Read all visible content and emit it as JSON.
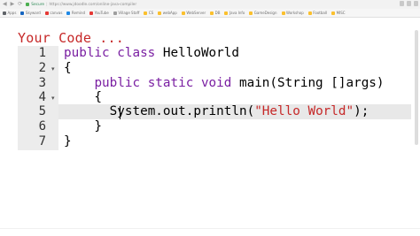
{
  "browser": {
    "secure_label": "Secure",
    "url": "https://www.jdoodle.com/online-java-compiler"
  },
  "bookmarks": [
    {
      "label": "Apps",
      "color": "#5f6368"
    },
    {
      "label": "Skyward",
      "color": "#1565c0"
    },
    {
      "label": "canvas",
      "color": "#e53935"
    },
    {
      "label": "Remind",
      "color": "#1e88e5"
    },
    {
      "label": "YouTube",
      "color": "#e53935"
    },
    {
      "label": "Village Staff",
      "color": "#9e9e9e"
    },
    {
      "label": "CS",
      "color": "#fbc02d"
    },
    {
      "label": "webApp",
      "color": "#fbc02d"
    },
    {
      "label": "WebServer",
      "color": "#fbc02d"
    },
    {
      "label": "DB",
      "color": "#fbc02d"
    },
    {
      "label": "Java Info",
      "color": "#fbc02d"
    },
    {
      "label": "GameDesign",
      "color": "#fbc02d"
    },
    {
      "label": "Workshop",
      "color": "#fbc02d"
    },
    {
      "label": "Football",
      "color": "#fbc02d"
    },
    {
      "label": "MISC",
      "color": "#fbc02d"
    }
  ],
  "page": {
    "heading": "Your Code ..."
  },
  "editor": {
    "active_line": 5,
    "lines": [
      {
        "num": "1",
        "fold": "",
        "tokens": [
          {
            "t": "public class ",
            "c": "kw"
          },
          {
            "t": "HelloWorld",
            "c": ""
          }
        ]
      },
      {
        "num": "2",
        "fold": "▾",
        "tokens": [
          {
            "t": "{",
            "c": ""
          }
        ]
      },
      {
        "num": "3",
        "fold": "",
        "tokens": [
          {
            "t": "    ",
            "c": ""
          },
          {
            "t": "public static void ",
            "c": "kw"
          },
          {
            "t": "main(String []args)",
            "c": ""
          }
        ]
      },
      {
        "num": "4",
        "fold": "▾",
        "tokens": [
          {
            "t": "    {",
            "c": ""
          }
        ]
      },
      {
        "num": "5",
        "fold": "",
        "tokens": [
          {
            "t": "      ",
            "c": ""
          },
          {
            "t": "System.out.println(",
            "c": ""
          },
          {
            "t": "\"Hello World\"",
            "c": "str"
          },
          {
            "t": ");",
            "c": ""
          }
        ]
      },
      {
        "num": "6",
        "fold": "",
        "tokens": [
          {
            "t": "    }",
            "c": ""
          }
        ]
      },
      {
        "num": "7",
        "fold": "",
        "tokens": [
          {
            "t": "}",
            "c": ""
          }
        ]
      }
    ]
  }
}
